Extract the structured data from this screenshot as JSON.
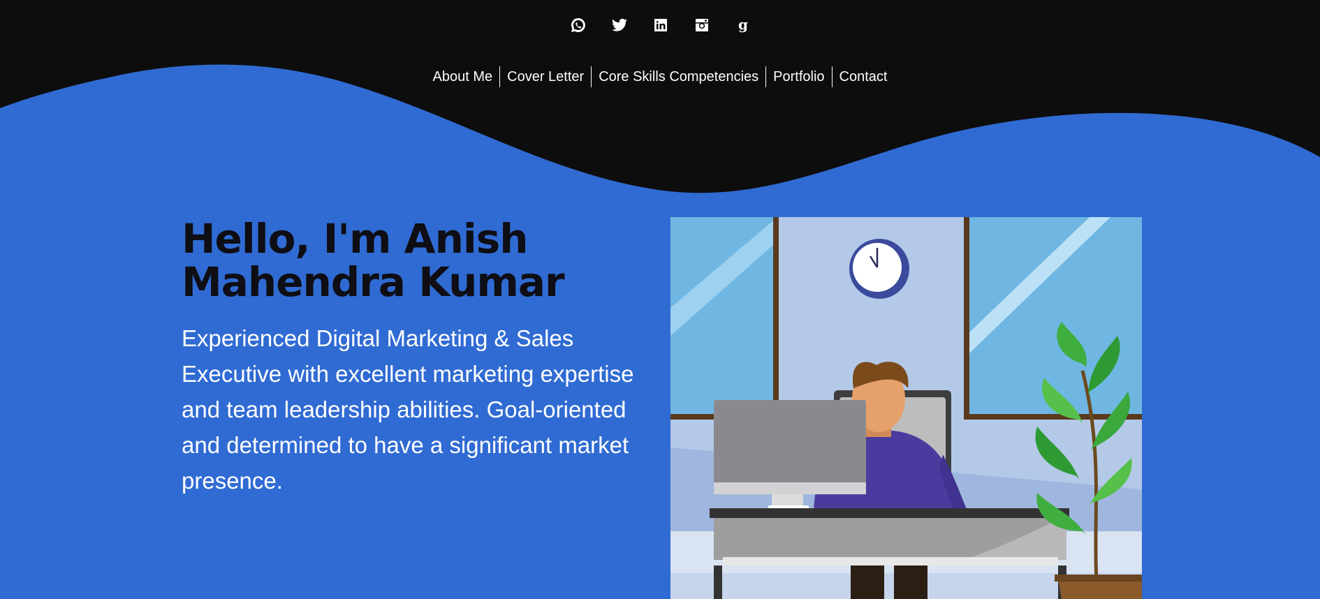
{
  "social": [
    {
      "name": "whatsapp-icon"
    },
    {
      "name": "twitter-icon"
    },
    {
      "name": "linkedin-icon"
    },
    {
      "name": "instagram-icon"
    },
    {
      "name": "google-icon"
    }
  ],
  "nav": {
    "items": [
      {
        "label": "About Me"
      },
      {
        "label": "Cover Letter"
      },
      {
        "label": "Core Skills Competencies"
      },
      {
        "label": "Portfolio"
      },
      {
        "label": "Contact"
      }
    ]
  },
  "hero": {
    "title_line1": "Hello, I'm Anish",
    "title_line2": "Mahendra Kumar",
    "description": "Experienced Digital Marketing & Sales Executive with excellent marketing expertise and team leadership abilities. Goal-oriented and determined to have a significant market presence."
  },
  "colors": {
    "background_blue": "#306bd3",
    "header_black": "#0d0d0d",
    "text_white": "#ffffff",
    "title_dark": "#0e0e14"
  }
}
